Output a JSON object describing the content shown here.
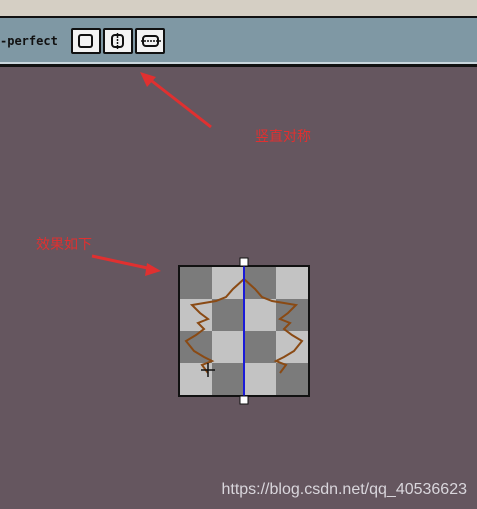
{
  "toolbar": {
    "label": "-perfect",
    "buttons": [
      {
        "icon": "square-outline-icon"
      },
      {
        "icon": "vertical-symmetry-icon"
      },
      {
        "icon": "horizontal-symmetry-icon"
      }
    ]
  },
  "annotations": {
    "vertical_symmetry": "竖直对称",
    "result": "效果如下"
  },
  "colors": {
    "background": "#65565f",
    "toolbar": "#7f98a4",
    "annotation": "#e03030",
    "symmetry_line": "#1a1ad8",
    "stroke": "#8a4a14"
  },
  "watermark": "https://blog.csdn.net/qq_40536623"
}
